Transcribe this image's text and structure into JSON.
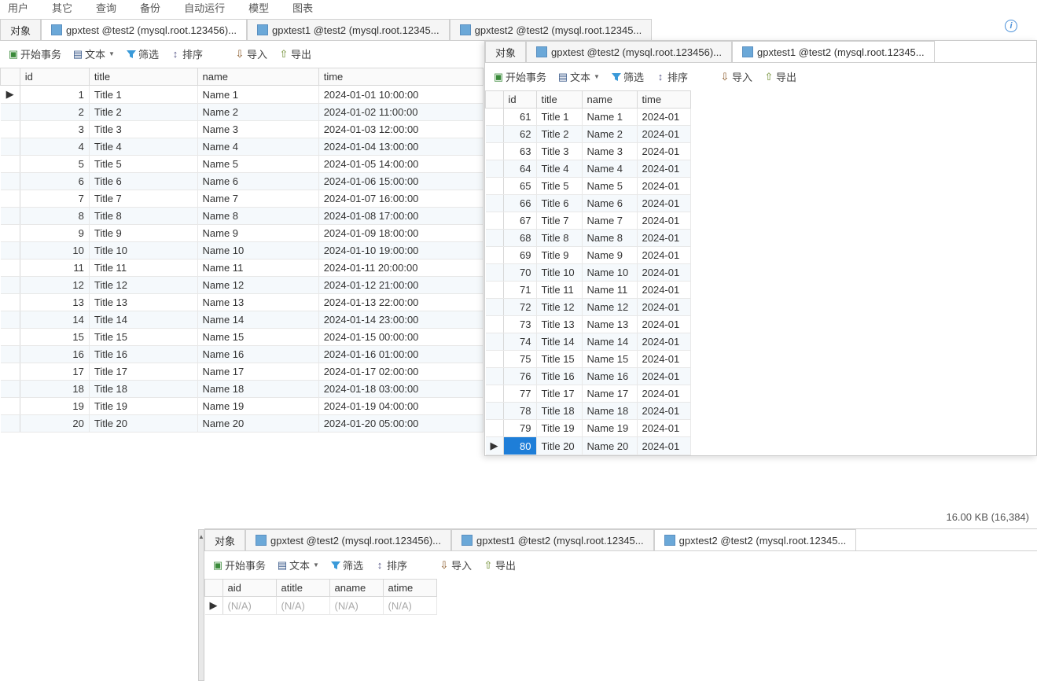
{
  "menu": [
    "用户",
    "其它",
    "查询",
    "备份",
    "自动运行",
    "模型",
    "图表"
  ],
  "main_tabs": {
    "obj": "对象",
    "t1": "gpxtest @test2 (mysql.root.123456)...",
    "t2": "gpxtest1 @test2 (mysql.root.12345...",
    "t3": "gpxtest2 @test2 (mysql.root.12345..."
  },
  "toolbar": {
    "begin": "开始事务",
    "text": "文本",
    "filter": "筛选",
    "sort": "排序",
    "import": "导入",
    "export": "导出"
  },
  "cols": {
    "id": "id",
    "title": "title",
    "name": "name",
    "time": "time"
  },
  "table1_widths": {
    "marker": 12,
    "id": 80,
    "title": 125,
    "name": 140,
    "time": 190
  },
  "table1": [
    {
      "id": 1,
      "title": "Title 1",
      "name": "Name 1",
      "time": "2024-01-01 10:00:00"
    },
    {
      "id": 2,
      "title": "Title 2",
      "name": "Name 2",
      "time": "2024-01-02 11:00:00"
    },
    {
      "id": 3,
      "title": "Title 3",
      "name": "Name 3",
      "time": "2024-01-03 12:00:00"
    },
    {
      "id": 4,
      "title": "Title 4",
      "name": "Name 4",
      "time": "2024-01-04 13:00:00"
    },
    {
      "id": 5,
      "title": "Title 5",
      "name": "Name 5",
      "time": "2024-01-05 14:00:00"
    },
    {
      "id": 6,
      "title": "Title 6",
      "name": "Name 6",
      "time": "2024-01-06 15:00:00"
    },
    {
      "id": 7,
      "title": "Title 7",
      "name": "Name 7",
      "time": "2024-01-07 16:00:00"
    },
    {
      "id": 8,
      "title": "Title 8",
      "name": "Name 8",
      "time": "2024-01-08 17:00:00"
    },
    {
      "id": 9,
      "title": "Title 9",
      "name": "Name 9",
      "time": "2024-01-09 18:00:00"
    },
    {
      "id": 10,
      "title": "Title 10",
      "name": "Name 10",
      "time": "2024-01-10 19:00:00"
    },
    {
      "id": 11,
      "title": "Title 11",
      "name": "Name 11",
      "time": "2024-01-11 20:00:00"
    },
    {
      "id": 12,
      "title": "Title 12",
      "name": "Name 12",
      "time": "2024-01-12 21:00:00"
    },
    {
      "id": 13,
      "title": "Title 13",
      "name": "Name 13",
      "time": "2024-01-13 22:00:00"
    },
    {
      "id": 14,
      "title": "Title 14",
      "name": "Name 14",
      "time": "2024-01-14 23:00:00"
    },
    {
      "id": 15,
      "title": "Title 15",
      "name": "Name 15",
      "time": "2024-01-15 00:00:00"
    },
    {
      "id": 16,
      "title": "Title 16",
      "name": "Name 16",
      "time": "2024-01-16 01:00:00"
    },
    {
      "id": 17,
      "title": "Title 17",
      "name": "Name 17",
      "time": "2024-01-17 02:00:00"
    },
    {
      "id": 18,
      "title": "Title 18",
      "name": "Name 18",
      "time": "2024-01-18 03:00:00"
    },
    {
      "id": 19,
      "title": "Title 19",
      "name": "Name 19",
      "time": "2024-01-19 04:00:00"
    },
    {
      "id": 20,
      "title": "Title 20",
      "name": "Name 20",
      "time": "2024-01-20 05:00:00"
    }
  ],
  "panel2_tabs": {
    "obj": "对象",
    "t1": "gpxtest @test2 (mysql.root.123456)...",
    "t2": "gpxtest1 @test2 (mysql.root.12345..."
  },
  "table2_widths": {
    "marker": 12,
    "id": 42,
    "title": 58,
    "name": 70,
    "time": 68
  },
  "table2": [
    {
      "id": 61,
      "title": "Title 1",
      "name": "Name 1",
      "time": "2024-01"
    },
    {
      "id": 62,
      "title": "Title 2",
      "name": "Name 2",
      "time": "2024-01"
    },
    {
      "id": 63,
      "title": "Title 3",
      "name": "Name 3",
      "time": "2024-01"
    },
    {
      "id": 64,
      "title": "Title 4",
      "name": "Name 4",
      "time": "2024-01"
    },
    {
      "id": 65,
      "title": "Title 5",
      "name": "Name 5",
      "time": "2024-01"
    },
    {
      "id": 66,
      "title": "Title 6",
      "name": "Name 6",
      "time": "2024-01"
    },
    {
      "id": 67,
      "title": "Title 7",
      "name": "Name 7",
      "time": "2024-01"
    },
    {
      "id": 68,
      "title": "Title 8",
      "name": "Name 8",
      "time": "2024-01"
    },
    {
      "id": 69,
      "title": "Title 9",
      "name": "Name 9",
      "time": "2024-01"
    },
    {
      "id": 70,
      "title": "Title 10",
      "name": "Name 10",
      "time": "2024-01"
    },
    {
      "id": 71,
      "title": "Title 11",
      "name": "Name 11",
      "time": "2024-01"
    },
    {
      "id": 72,
      "title": "Title 12",
      "name": "Name 12",
      "time": "2024-01"
    },
    {
      "id": 73,
      "title": "Title 13",
      "name": "Name 13",
      "time": "2024-01"
    },
    {
      "id": 74,
      "title": "Title 14",
      "name": "Name 14",
      "time": "2024-01"
    },
    {
      "id": 75,
      "title": "Title 15",
      "name": "Name 15",
      "time": "2024-01"
    },
    {
      "id": 76,
      "title": "Title 16",
      "name": "Name 16",
      "time": "2024-01"
    },
    {
      "id": 77,
      "title": "Title 17",
      "name": "Name 17",
      "time": "2024-01"
    },
    {
      "id": 78,
      "title": "Title 18",
      "name": "Name 18",
      "time": "2024-01"
    },
    {
      "id": 79,
      "title": "Title 19",
      "name": "Name 19",
      "time": "2024-01"
    },
    {
      "id": 80,
      "title": "Title 20",
      "name": "Name 20",
      "time": "2024-01"
    }
  ],
  "panel3_tabs": {
    "obj": "对象",
    "t1": "gpxtest @test2 (mysql.root.123456)...",
    "t2": "gpxtest1 @test2 (mysql.root.12345...",
    "t3": "gpxtest2 @test2 (mysql.root.12345..."
  },
  "cols3": {
    "aid": "aid",
    "atitle": "atitle",
    "aname": "aname",
    "atime": "atime"
  },
  "na": "(N/A)",
  "status": "16.00 KB (16,384)"
}
